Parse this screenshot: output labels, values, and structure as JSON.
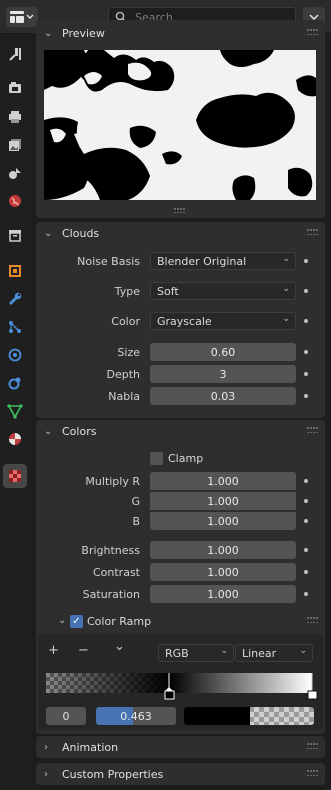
{
  "topbar": {
    "search_placeholder": "Search",
    "editor_icon": "properties-editor-icon",
    "options_icon": "chevron-down-icon"
  },
  "tabs": [
    {
      "name": "tool-tab",
      "icon": "wrench-screwdriver-icon",
      "active": false
    },
    {
      "name": "render-tab",
      "icon": "camera-back-icon",
      "active": false
    },
    {
      "name": "output-tab",
      "icon": "printer-icon",
      "active": false
    },
    {
      "name": "view-layer-tab",
      "icon": "image-stack-icon",
      "active": false
    },
    {
      "name": "scene-tab",
      "icon": "scene-icon",
      "active": false
    },
    {
      "name": "world-tab",
      "icon": "globe-icon",
      "active": false
    },
    {
      "name": "collection-tab",
      "icon": "box-icon",
      "active": false
    },
    {
      "name": "object-tab",
      "icon": "orange-square-icon",
      "active": false
    },
    {
      "name": "modifier-tab",
      "icon": "wrench-icon",
      "active": false
    },
    {
      "name": "particles-tab",
      "icon": "particles-icon",
      "active": false
    },
    {
      "name": "physics-tab",
      "icon": "physics-orbit-icon",
      "active": false
    },
    {
      "name": "constraints-tab",
      "icon": "constraint-icon",
      "active": false
    },
    {
      "name": "data-tab",
      "icon": "triangle-mesh-icon",
      "active": false
    },
    {
      "name": "material-tab",
      "icon": "material-sphere-icon",
      "active": false
    },
    {
      "name": "texture-tab",
      "icon": "checker-texture-icon",
      "active": true
    }
  ],
  "preview": {
    "title": "Preview"
  },
  "clouds": {
    "title": "Clouds",
    "noise_basis_label": "Noise Basis",
    "noise_basis_value": "Blender Original",
    "type_label": "Type",
    "type_value": "Soft",
    "color_label": "Color",
    "color_value": "Grayscale",
    "size_label": "Size",
    "size_value": "0.60",
    "depth_label": "Depth",
    "depth_value": "3",
    "nabla_label": "Nabla",
    "nabla_value": "0.03"
  },
  "colors": {
    "title": "Colors",
    "clamp_label": "Clamp",
    "clamp_checked": false,
    "multiply_r_label": "Multiply R",
    "multiply_r_value": "1.000",
    "g_label": "G",
    "g_value": "1.000",
    "b_label": "B",
    "b_value": "1.000",
    "brightness_label": "Brightness",
    "brightness_value": "1.000",
    "contrast_label": "Contrast",
    "contrast_value": "1.000",
    "saturation_label": "Saturation",
    "saturation_value": "1.000",
    "color_ramp_label": "Color Ramp",
    "color_ramp_checked": true
  },
  "ramp": {
    "add_label": "+",
    "remove_label": "−",
    "menu_label": "⌄",
    "color_mode": "RGB",
    "interpolation": "Linear",
    "active_index": "0",
    "position": "0.463",
    "position_fraction": 0.463,
    "active_color": "#000000"
  },
  "animation": {
    "title": "Animation"
  },
  "custom_properties": {
    "title": "Custom Properties"
  },
  "colors_theme": {
    "accent": "#4772b3",
    "panel": "#2e2e2e",
    "field": "#545454"
  }
}
